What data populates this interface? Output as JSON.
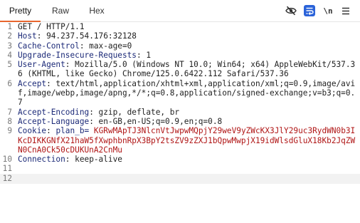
{
  "tabs": [
    {
      "label": "Pretty",
      "active": true
    },
    {
      "label": "Raw",
      "active": false
    },
    {
      "label": "Hex",
      "active": false
    }
  ],
  "toolbar": {
    "hide_icon": "eye-slash-icon",
    "wrap_icon": "wrap-lines-icon",
    "newline_label": "\\n",
    "menu_icon": "hamburger-menu-icon",
    "accent_color": "#2b63d9"
  },
  "request": {
    "lines": [
      {
        "n": "1",
        "key": "",
        "text": "GET / HTTP/1.1"
      },
      {
        "n": "2",
        "key": "Host",
        "text": ": 94.237.54.176:32128"
      },
      {
        "n": "3",
        "key": "Cache-Control",
        "text": ": max-age=0"
      },
      {
        "n": "4",
        "key": "Upgrade-Insecure-Requests",
        "text": ": 1"
      },
      {
        "n": "5",
        "key": "User-Agent",
        "text": ": Mozilla/5.0 (Windows NT 10.0; Win64; x64) AppleWebKit/537.36 (KHTML, like Gecko) Chrome/125.0.6422.112 Safari/537.36"
      },
      {
        "n": "6",
        "key": "Accept",
        "text": ": text/html,application/xhtml+xml,application/xml;q=0.9,image/avif,image/webp,image/apng,*/*;q=0.8,application/signed-exchange;v=b3;q=0.7"
      },
      {
        "n": "7",
        "key": "Accept-Encoding",
        "text": ": gzip, deflate, br"
      },
      {
        "n": "8",
        "key": "Accept-Language",
        "text": ": en-GB,en-US;q=0.9,en;q=0.8"
      },
      {
        "n": "9",
        "key": "Cookie",
        "text": ": ",
        "cookie_name": "plan_b=",
        "cookie_value": "KGRwMApTJ3NlcnVtJwpwMQpjY29weV9yZWcKX3JlY29uc3RydWN0b3IKcDIKKGNfX21haW5fXwphbnRpX3BpY2tsZV9zZXJ1bQpwMwpjX19idWlsdGluX18Kb2JqZWN0CnA0Ck50cDUKUnA2CnMu"
      },
      {
        "n": "10",
        "key": "Connection",
        "text": ": keep-alive"
      },
      {
        "n": "11",
        "key": "",
        "text": ""
      },
      {
        "n": "12",
        "key": "",
        "text": ""
      }
    ]
  }
}
